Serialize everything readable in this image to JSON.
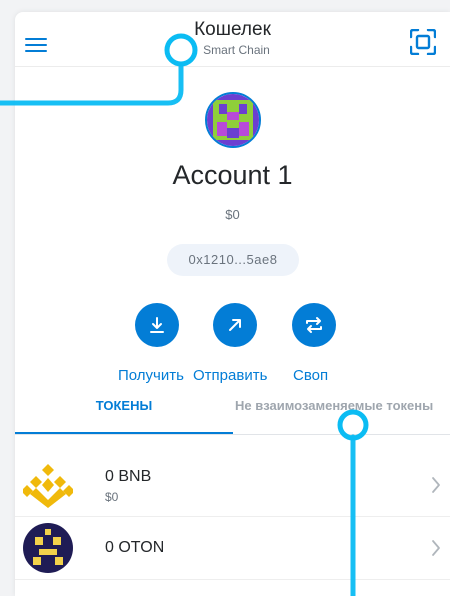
{
  "header": {
    "title": "Кошелек",
    "network": "Smart Chain",
    "menu_icon": "hamburger-icon",
    "scan_icon": "qr-scan-icon"
  },
  "account": {
    "name": "Account 1",
    "balance": "$0",
    "address": "0x1210...5ae8"
  },
  "actions": [
    {
      "label": "Получить",
      "icon": "download-arrow-icon"
    },
    {
      "label": "Отправить",
      "icon": "arrow-up-right-icon"
    },
    {
      "label": "Своп",
      "icon": "swap-arrows-icon"
    }
  ],
  "tabs": [
    {
      "label": "ТОКЕНЫ",
      "active": true
    },
    {
      "label": "Не взаимозаменяемые токены",
      "active": false
    }
  ],
  "tokens": [
    {
      "amount": "0 BNB",
      "fiat": "$0",
      "icon": "bnb-logo-icon"
    },
    {
      "amount": "0 OTON",
      "fiat": "",
      "icon": "oton-logo-icon"
    }
  ],
  "colors": {
    "accent": "#037dd6",
    "highlight": "#0bbcf3",
    "bnb": "#f0b90b",
    "oton_bg": "#1f1c55"
  }
}
